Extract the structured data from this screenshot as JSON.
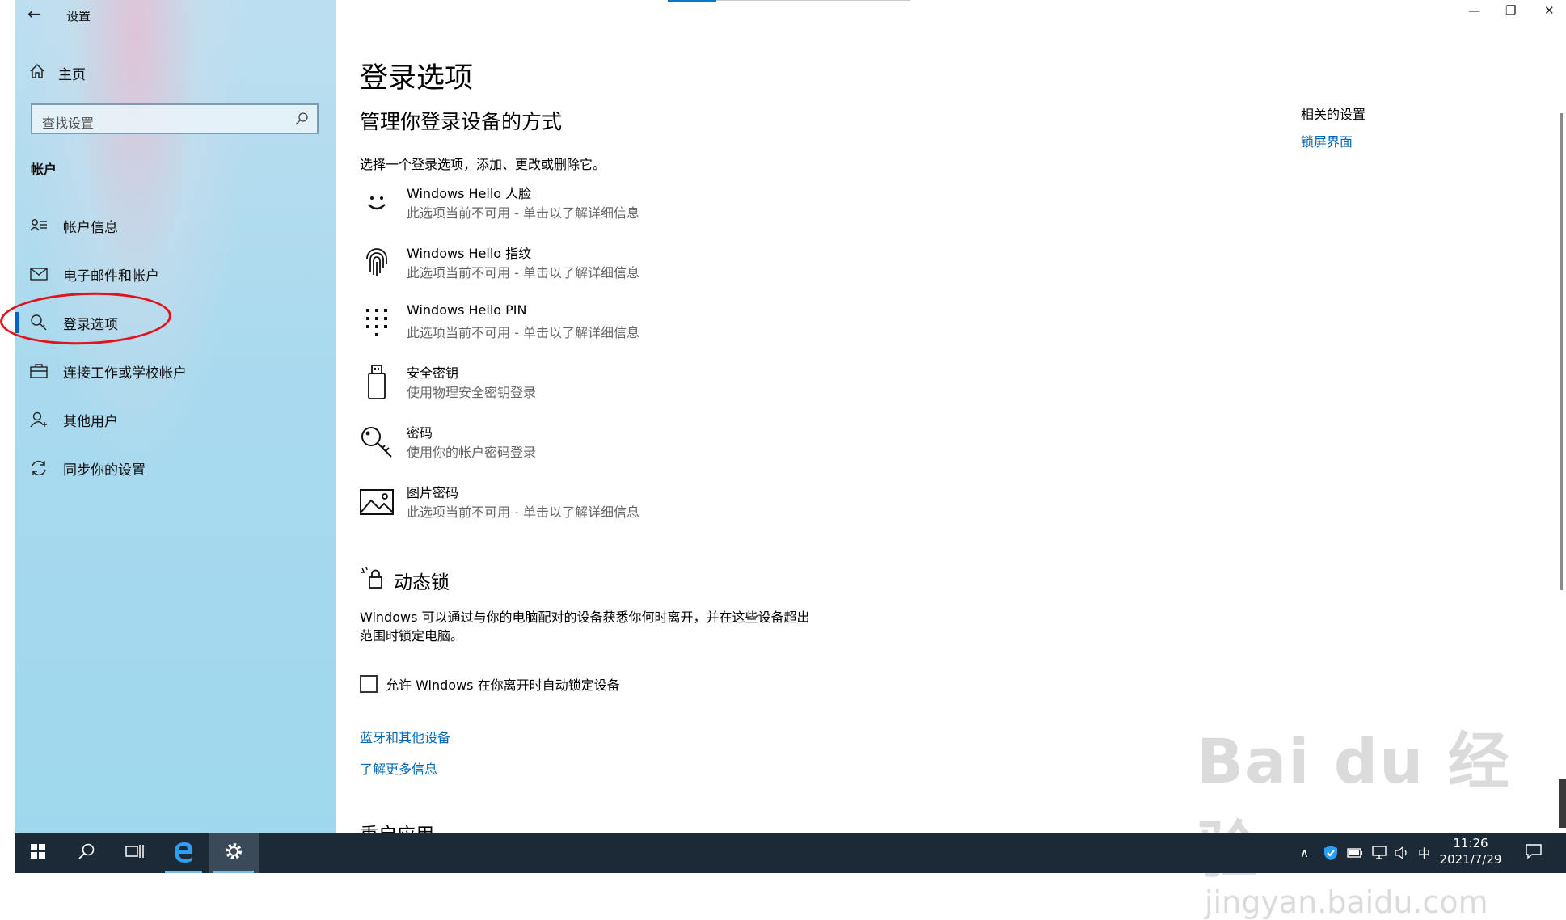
{
  "window": {
    "title": "设置",
    "back_glyph": "←",
    "minimize": "—",
    "restore": "❐",
    "close": "✕"
  },
  "sidebar": {
    "home_label": "主页",
    "search_placeholder": "查找设置",
    "group_title": "帐户",
    "items": [
      {
        "label": "帐户信息",
        "icon": "account-info-icon"
      },
      {
        "label": "电子邮件和帐户",
        "icon": "mail-icon"
      },
      {
        "label": "登录选项",
        "icon": "key-icon",
        "active": true
      },
      {
        "label": "连接工作或学校帐户",
        "icon": "briefcase-icon"
      },
      {
        "label": "其他用户",
        "icon": "add-person-icon"
      },
      {
        "label": "同步你的设置",
        "icon": "sync-icon"
      }
    ]
  },
  "main": {
    "title": "登录选项",
    "subtitle": "管理你登录设备的方式",
    "description": "选择一个登录选项，添加、更改或删除它。",
    "options": [
      {
        "title": "Windows Hello 人脸",
        "subtitle": "此选项当前不可用 - 单击以了解详细信息",
        "icon": "face-icon"
      },
      {
        "title": "Windows Hello 指纹",
        "subtitle": "此选项当前不可用 - 单击以了解详细信息",
        "icon": "fingerprint-icon"
      },
      {
        "title": "Windows Hello PIN",
        "subtitle": "此选项当前不可用 - 单击以了解详细信息",
        "icon": "pin-keypad-icon"
      },
      {
        "title": "安全密钥",
        "subtitle": "使用物理安全密钥登录",
        "icon": "usb-key-icon"
      },
      {
        "title": "密码",
        "subtitle": "使用你的帐户密码登录",
        "icon": "password-key-icon"
      },
      {
        "title": "图片密码",
        "subtitle": "此选项当前不可用 - 单击以了解详细信息",
        "icon": "picture-icon"
      }
    ],
    "dynamic_lock": {
      "heading": "动态锁",
      "description": "Windows 可以通过与你的电脑配对的设备获悉你何时离开，并在这些设备超出范围时锁定电脑。",
      "checkbox_label": "允许 Windows 在你离开时自动锁定设备",
      "checked": false
    },
    "links": {
      "bluetooth": "蓝牙和其他设备",
      "learn_more": "了解更多信息"
    },
    "next_heading": "重启应用"
  },
  "related": {
    "title": "相关的设置",
    "link": "锁屏界面"
  },
  "watermark": {
    "main": "Bai du 经验",
    "sub": "jingyan.baidu.com"
  },
  "taskbar": {
    "time": "11:26",
    "date": "2021/7/29",
    "ime": "中",
    "tray_caret": "∧"
  },
  "colors": {
    "accent": "#0067c0",
    "link": "#0067b8",
    "annotation": "#e0141e",
    "taskbar": "#1c2a38"
  }
}
